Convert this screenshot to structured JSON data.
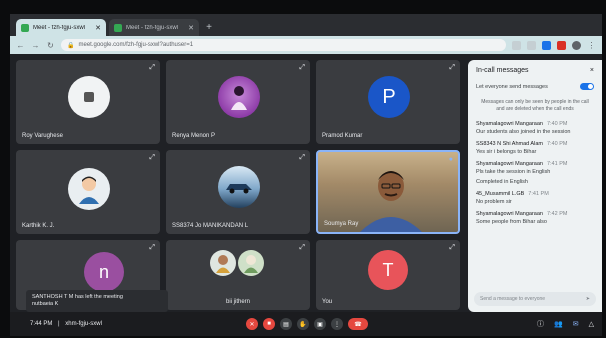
{
  "browser": {
    "tabs": [
      {
        "title": "Meet - fzh-fgju-sxwl",
        "active": true
      },
      {
        "title": "Meet - fzh-fgju-sxwl",
        "active": false
      }
    ],
    "url": "meet.google.com/fzh-fgju-sxwl?authuser=1"
  },
  "tiles": [
    {
      "name": "Roy Varughese",
      "avatar": "image"
    },
    {
      "name": "Renya Menon P",
      "avatar": "image"
    },
    {
      "name": "Pramod Kumar",
      "avatar": "letter",
      "letter": "P"
    },
    {
      "name": "Karthik K. J.",
      "avatar": "image"
    },
    {
      "name": "SS8374 Jo MANIKANDAN L",
      "avatar": "image"
    },
    {
      "name": "Soumya Ray",
      "avatar": "video"
    },
    {
      "name": "",
      "avatar": "letter",
      "letter": "n"
    },
    {
      "name": "bii jithern",
      "avatar": "image"
    },
    {
      "name": "You",
      "avatar": "letter",
      "letter": "T"
    }
  ],
  "toast": {
    "line1": "SANTHOSH T M has left the meeting",
    "line2": "nutbaeia K"
  },
  "bottom": {
    "time": "7:44 PM",
    "separator": "|",
    "meeting_code": "xhm-fgju-sxwl"
  },
  "chat": {
    "title": "In-call messages",
    "close": "×",
    "toggle_label": "Let everyone send messages",
    "toggle_on": true,
    "note": "Messages can only be seen by people in the call and are deleted when the call ends",
    "messages": [
      {
        "from": "Shyamalagowri Mangaraan",
        "time": "7:40 PM",
        "text": "Our students also joined in the session"
      },
      {
        "from": "SS8343 N Shi Ahmad Alam",
        "time": "7:40 PM",
        "text": "Yes sir i belongs to Bihar"
      },
      {
        "from": "Shyamalagowri Mangaraan",
        "time": "7:41 PM",
        "text": "Pls take the session in English"
      },
      {
        "from": "",
        "time": "",
        "text": "Completed in English"
      },
      {
        "from": "45_Musammil L.GB",
        "time": "7:41 PM",
        "text": "No problem sir"
      },
      {
        "from": "Shyamalagowri Mangaraan",
        "time": "7:42 PM",
        "text": "Some people from Bihar also"
      }
    ],
    "compose_placeholder": "Send a message to everyone",
    "send_icon": "send-icon"
  },
  "colors": {
    "end_call": "#e5483f",
    "accent": "#1a73e8",
    "panel_bg": "#eef2f3"
  }
}
